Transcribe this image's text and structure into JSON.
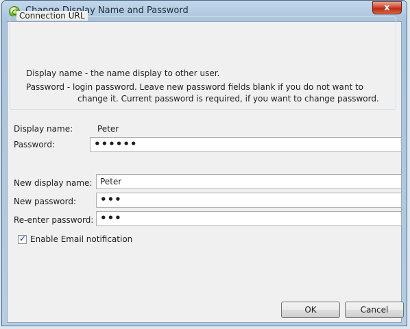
{
  "window": {
    "title": "Change Display Name and Password",
    "close_label": "x"
  },
  "connection_group": {
    "title": "Connection URL",
    "line1": "Display name - the name display to other user.",
    "line2": "Password - login password. Leave new password fields blank if you do not want to",
    "line3": "change it. Current password is required, if you want to change password."
  },
  "current": {
    "display_name_label": "Display name:",
    "display_name_value": "Peter",
    "password_label": "Password:",
    "password_value": "••••••"
  },
  "new": {
    "display_name_label": "New display name:",
    "display_name_value": "Peter",
    "password_label": "New password:",
    "password_value": "•••",
    "reenter_label": "Re-enter password:",
    "reenter_value": "•••"
  },
  "email_notification": {
    "label": "Enable Email notification",
    "checked": true
  },
  "buttons": {
    "ok": "OK",
    "cancel": "Cancel"
  }
}
